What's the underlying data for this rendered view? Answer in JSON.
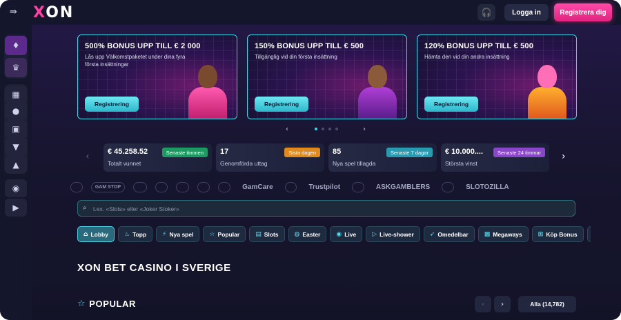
{
  "header": {
    "logo": "XON",
    "login_label": "Logga in",
    "register_label": "Registrera dig"
  },
  "banners": [
    {
      "title": "500% BONUS UPP TILL € 2 000",
      "desc": "Lås upp Välkomstpaketet under dina fyra första insättningar",
      "cta": "Registrering"
    },
    {
      "title": "150% BONUS UPP TILL € 500",
      "desc": "Tillgänglig vid din första insättning",
      "cta": "Registrering"
    },
    {
      "title": "120% BONUS UPP TILL € 500",
      "desc": "Hämta den vid din andra insättning",
      "cta": "Registrering"
    }
  ],
  "stats": [
    {
      "value": "€ 45.258.52",
      "label": "Totalt vunnet",
      "badge": "Senaste timmen",
      "badge_color": "#1d9a62"
    },
    {
      "value": "17",
      "label": "Genomförda uttag",
      "badge": "Sista dagen",
      "badge_color": "#e08a1e"
    },
    {
      "value": "85",
      "label": "Nya spel tillagda",
      "badge": "Senaste 7 dagar",
      "badge_color": "#2a9ab0"
    },
    {
      "value": "€ 10.000....",
      "label": "Största vinst",
      "badge": "Senaste 24 timmar",
      "badge_color": "#8a46c9"
    }
  ],
  "partners": [
    "GAM STOP",
    "GamCare",
    "Trustpilot",
    "ASKGAMBLERS",
    "SLOTOZILLA"
  ],
  "search": {
    "placeholder": "t.ex. «Slots» eller «Joker Stoker»"
  },
  "categories": [
    {
      "label": "Lobby",
      "icon": "home-icon"
    },
    {
      "label": "Topp",
      "icon": "fire-icon"
    },
    {
      "label": "Nya spel",
      "icon": "bolt-icon"
    },
    {
      "label": "Popular",
      "icon": "star-icon"
    },
    {
      "label": "Slots",
      "icon": "slots-icon"
    },
    {
      "label": "Easter",
      "icon": "egg-icon"
    },
    {
      "label": "Live",
      "icon": "live-icon"
    },
    {
      "label": "Live-shower",
      "icon": "play-icon"
    },
    {
      "label": "Omedelbar",
      "icon": "rocket-icon"
    },
    {
      "label": "Megaways",
      "icon": "megaways-icon"
    },
    {
      "label": "Köp Bonus",
      "icon": "bonus-icon"
    }
  ],
  "main": {
    "page_heading": "XON BET CASINO I SVERIGE",
    "section_title": "POPULAR",
    "all_label": "Alla (14,782)"
  }
}
